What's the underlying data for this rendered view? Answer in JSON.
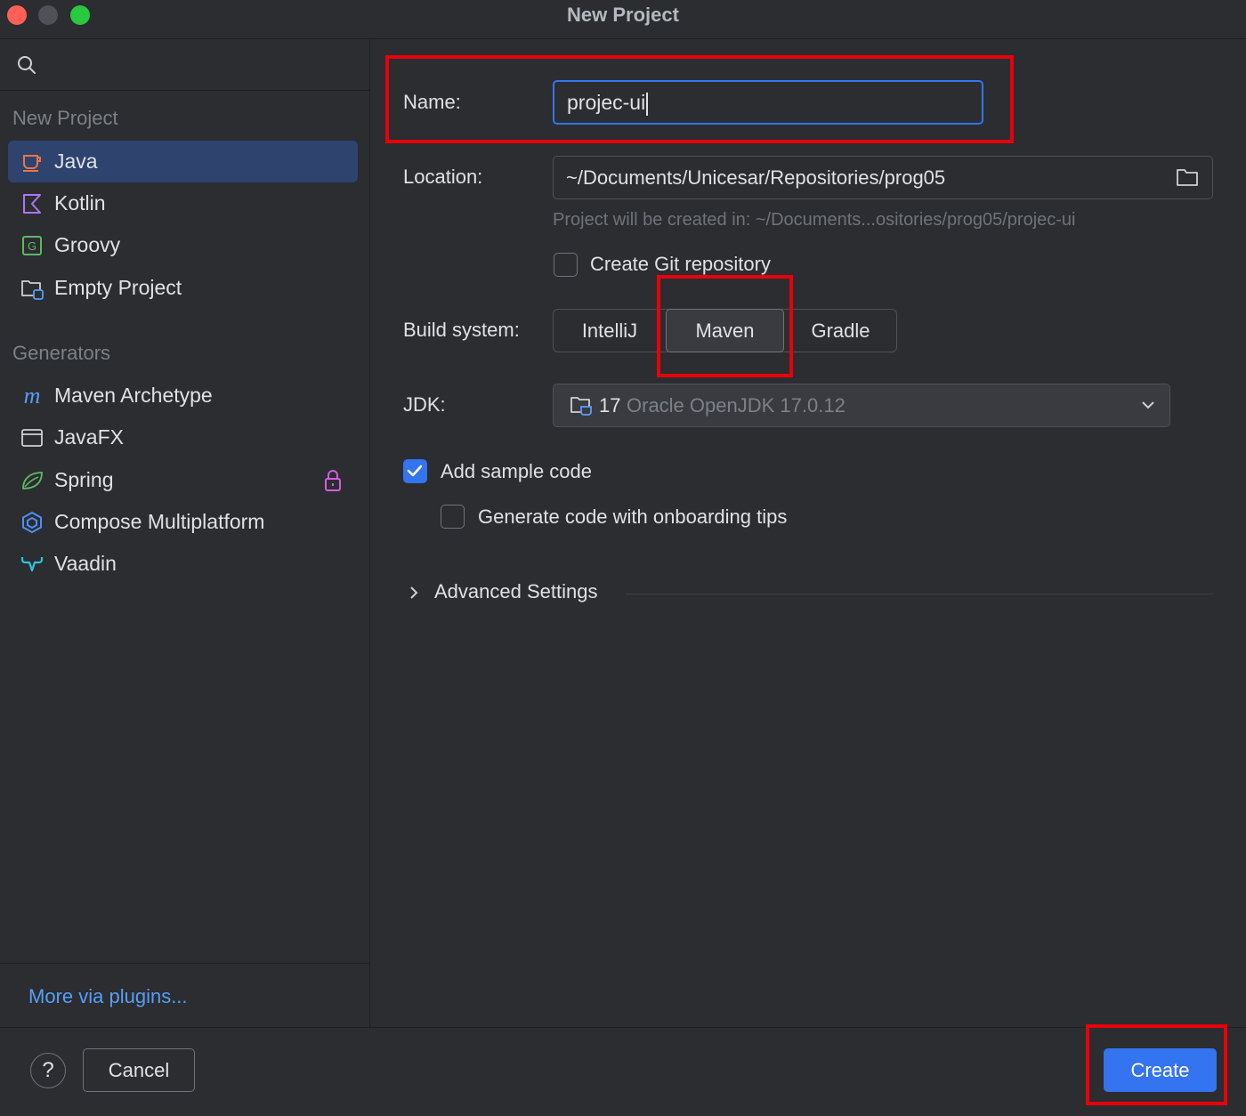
{
  "window": {
    "title": "New Project"
  },
  "sidebar": {
    "search_icon": "search-icon",
    "section_new_project": "New Project",
    "new_project_items": [
      {
        "label": "Java",
        "icon": "java-icon",
        "selected": true
      },
      {
        "label": "Kotlin",
        "icon": "kotlin-icon",
        "selected": false
      },
      {
        "label": "Groovy",
        "icon": "groovy-icon",
        "selected": false
      },
      {
        "label": "Empty Project",
        "icon": "empty-project-icon",
        "selected": false
      }
    ],
    "section_generators": "Generators",
    "generator_items": [
      {
        "label": "Maven Archetype",
        "icon": "maven-icon"
      },
      {
        "label": "JavaFX",
        "icon": "javafx-icon"
      },
      {
        "label": "Spring",
        "icon": "spring-icon",
        "locked": true
      },
      {
        "label": "Compose Multiplatform",
        "icon": "compose-icon"
      },
      {
        "label": "Vaadin",
        "icon": "vaadin-icon"
      }
    ],
    "more_plugins_link": "More via plugins..."
  },
  "form": {
    "name_label": "Name:",
    "name_value": "projec-ui",
    "location_label": "Location:",
    "location_value": "~/Documents/Unicesar/Repositories/prog05",
    "location_hint": "Project will be created in: ~/Documents...ositories/prog05/projec-ui",
    "create_git_label": "Create Git repository",
    "create_git_checked": false,
    "build_system_label": "Build system:",
    "build_systems": [
      "IntelliJ",
      "Maven",
      "Gradle"
    ],
    "build_system_selected": "Maven",
    "jdk_label": "JDK:",
    "jdk_version": "17",
    "jdk_name": "Oracle OpenJDK 17.0.12",
    "add_sample_code_label": "Add sample code",
    "add_sample_code_checked": true,
    "onboarding_tips_label": "Generate code with onboarding tips",
    "onboarding_tips_checked": false,
    "advanced_settings_label": "Advanced Settings"
  },
  "footer": {
    "help_label": "?",
    "cancel_label": "Cancel",
    "create_label": "Create"
  },
  "colors": {
    "background": "#2b2d30",
    "accent": "#3574f0",
    "selected_item": "#2e436e",
    "link": "#589df6",
    "annotation_red": "#e8000b"
  }
}
